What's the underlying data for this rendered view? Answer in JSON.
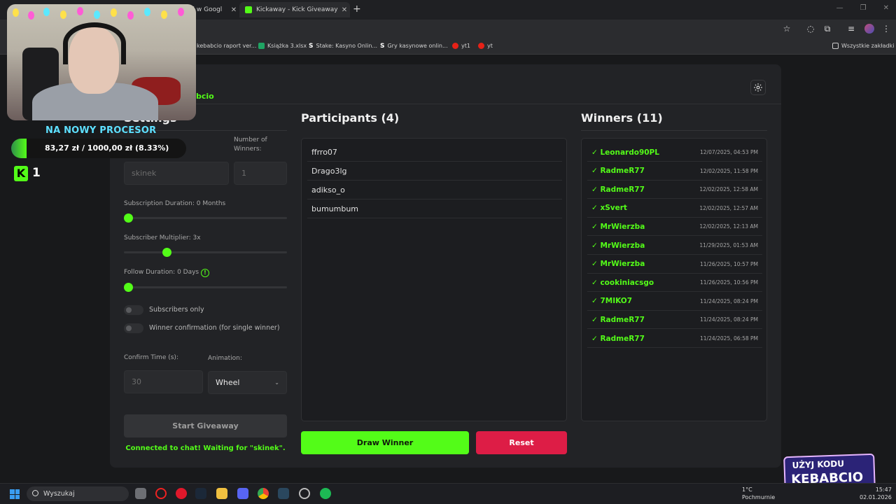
{
  "browser": {
    "tabs": [
      {
        "label": "aj w Googl"
      },
      {
        "label": "Kickaway - Kick Giveaway Tool"
      }
    ],
    "bookmarks": [
      {
        "label": "kebabcio raport ver..."
      },
      {
        "label": "Książka 3.xlsx"
      },
      {
        "label": "Stake: Kasyno Onlin..."
      },
      {
        "label": "Gry kasynowe onlin..."
      },
      {
        "label": "yt1"
      },
      {
        "label": "yt"
      }
    ],
    "all_bookmarks_label": "Wszystkie zakładki"
  },
  "app": {
    "brand_partial": "bcio",
    "settings": {
      "title": "Settings",
      "winners_label": "Number of Winners:",
      "keyword_placeholder": "skinek",
      "winners_placeholder": "1",
      "sub_duration_label": "Subscription Duration: 0 Months",
      "sub_duration_value": 0,
      "sub_multiplier_label": "Subscriber Multiplier: 3x",
      "sub_multiplier_value": 0.25,
      "follow_duration_label": "Follow Duration: 0 Days",
      "follow_duration_value": 0,
      "info_glyph": "!",
      "toggles": [
        {
          "label": "Subscribers only",
          "on": false
        },
        {
          "label": "Winner confirmation (for single winner)",
          "on": false
        }
      ],
      "confirm_time_label": "Confirm Time (s):",
      "confirm_time_placeholder": "30",
      "animation_label": "Animation:",
      "animation_value": "Wheel",
      "start_button": "Start Giveaway",
      "status": "Connected to chat! Waiting for \"skinek\"."
    },
    "participants": {
      "title": "Participants (4)",
      "items": [
        "ffrro07",
        "Drago3lg",
        "adikso_o",
        "bumumbum"
      ]
    },
    "winners": {
      "title": "Winners (11)",
      "items": [
        {
          "name": "✓ Leonardo90PL",
          "date": "12/07/2025, 04:53 PM"
        },
        {
          "name": "✓ RadmeR77",
          "date": "12/02/2025, 11:58 PM"
        },
        {
          "name": "✓ RadmeR77",
          "date": "12/02/2025, 12:58 AM"
        },
        {
          "name": "✓ xSvert",
          "date": "12/02/2025, 12:57 AM"
        },
        {
          "name": "✓ MrWierzba",
          "date": "12/02/2025, 12:13 AM"
        },
        {
          "name": "✓ MrWierzba",
          "date": "11/29/2025, 01:53 AM"
        },
        {
          "name": "✓ MrWierzba",
          "date": "11/26/2025, 10:57 PM"
        },
        {
          "name": "✓ cookiniacsgo",
          "date": "11/26/2025, 10:56 PM"
        },
        {
          "name": "✓ 7MIKO7",
          "date": "11/24/2025, 08:24 PM"
        },
        {
          "name": "✓ RadmeR77",
          "date": "11/24/2025, 08:24 PM"
        },
        {
          "name": "✓ RadmeR77",
          "date": "11/24/2025, 06:58 PM"
        }
      ]
    },
    "draw_button": "Draw Winner",
    "reset_button": "Reset"
  },
  "overlay": {
    "donation_title": "NA NOWY PROCESOR",
    "donation_text": "83,27 zł  /  1000,00 zł (8.33%)",
    "donation_progress": 0.0833,
    "kick_count": "1",
    "kick_glyph": "K",
    "promo_line1": "UŻYJ KODU",
    "promo_line2": "KEBABCIO"
  },
  "taskbar": {
    "search_placeholder": "Wyszukaj",
    "weather_temp": "1°C",
    "weather_desc": "Pochmurnie",
    "time": "15:47",
    "date": "02.01.2026"
  },
  "colors": {
    "accent": "#53fc18",
    "reset": "#dd1d46",
    "panel": "#222326"
  }
}
